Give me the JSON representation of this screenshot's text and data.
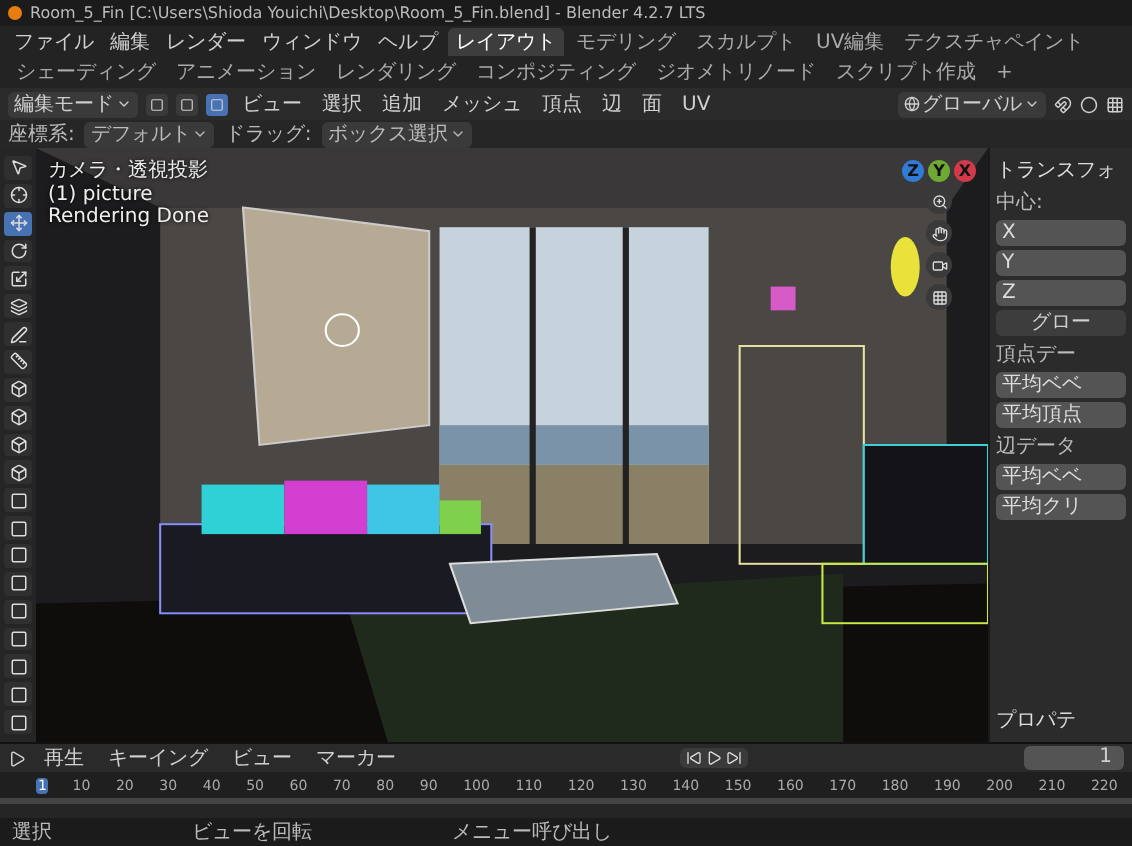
{
  "window": {
    "title": "Room_5_Fin [C:\\Users\\Shioda Youichi\\Desktop\\Room_5_Fin.blend] - Blender 4.2.7 LTS"
  },
  "menu": [
    "ファイル",
    "編集",
    "レンダー",
    "ウィンドウ",
    "ヘルプ"
  ],
  "workspaces": [
    {
      "label": "レイアウト",
      "selected": true
    },
    {
      "label": "モデリング",
      "selected": false
    },
    {
      "label": "スカルプト",
      "selected": false
    },
    {
      "label": "UV編集",
      "selected": false
    },
    {
      "label": "テクスチャペイント",
      "selected": false
    },
    {
      "label": "シェーディング",
      "selected": false
    },
    {
      "label": "アニメーション",
      "selected": false
    },
    {
      "label": "レンダリング",
      "selected": false
    },
    {
      "label": "コンポジティング",
      "selected": false
    },
    {
      "label": "ジオメトリノード",
      "selected": false
    },
    {
      "label": "スクリプト作成",
      "selected": false
    },
    {
      "label": "+",
      "selected": false
    }
  ],
  "header": {
    "mode": "編集モード",
    "select_modes": [
      {
        "selected": false
      },
      {
        "selected": false
      },
      {
        "selected": true
      }
    ],
    "menus": [
      "ビュー",
      "選択",
      "追加",
      "メッシュ",
      "頂点",
      "辺",
      "面",
      "UV"
    ],
    "orientation": "グローバル"
  },
  "subheader": {
    "label": "座標系:",
    "orientation": "デフォルト",
    "drag": "ドラッグ:",
    "select": "ボックス選択"
  },
  "overlay": [
    "カメラ・透視投影",
    "(1) picture",
    "Rendering Done"
  ],
  "tools": [
    {
      "kind": "select",
      "selected": false
    },
    {
      "kind": "cursor",
      "selected": false
    },
    {
      "kind": "move",
      "selected": true
    },
    {
      "kind": "rotate",
      "selected": false
    },
    {
      "kind": "scale",
      "selected": false
    },
    {
      "kind": "transform",
      "selected": false
    },
    {
      "kind": "annotate",
      "selected": false
    },
    {
      "kind": "measure",
      "selected": false
    },
    {
      "kind": "cube",
      "selected": false
    },
    {
      "kind": "extrude",
      "selected": false
    },
    {
      "kind": "inset",
      "selected": false
    },
    {
      "kind": "bevel",
      "selected": false
    },
    {
      "kind": "loopcut",
      "selected": false
    },
    {
      "kind": "knife",
      "selected": false
    },
    {
      "kind": "polybuild",
      "selected": false
    },
    {
      "kind": "spin",
      "selected": false
    },
    {
      "kind": "smooth",
      "selected": false
    },
    {
      "kind": "slide",
      "selected": false
    },
    {
      "kind": "shrink",
      "selected": false
    },
    {
      "kind": "shear",
      "selected": false
    },
    {
      "kind": "rip",
      "selected": false
    }
  ],
  "gizmo": {
    "axes": [
      {
        "label": "Z",
        "color": "#2f7bd6"
      },
      {
        "label": "Y",
        "color": "#6ea934"
      },
      {
        "label": "X",
        "color": "#d23a4a"
      }
    ]
  },
  "n_panel": {
    "title": "トランスフォ",
    "rows": [
      {
        "kind": "label",
        "text": "中心:"
      },
      {
        "kind": "field",
        "text": "X"
      },
      {
        "kind": "field",
        "text": "Y"
      },
      {
        "kind": "field",
        "text": "Z"
      },
      {
        "kind": "button",
        "text": "グロー"
      },
      {
        "kind": "label",
        "text": "頂点デー"
      },
      {
        "kind": "field",
        "text": "平均ベベ"
      },
      {
        "kind": "field",
        "text": "平均頂点"
      },
      {
        "kind": "label",
        "text": "辺データ"
      },
      {
        "kind": "field",
        "text": "平均ベベ"
      },
      {
        "kind": "field",
        "text": "平均クリ"
      }
    ],
    "footer": "プロパテ"
  },
  "timeline": {
    "menus": [
      "再生",
      "キーイング",
      "ビュー",
      "マーカー"
    ],
    "frame": "1",
    "ticks": [
      {
        "label": "1",
        "selected": true
      },
      {
        "label": "10",
        "selected": false
      },
      {
        "label": "20",
        "selected": false
      },
      {
        "label": "30",
        "selected": false
      },
      {
        "label": "40",
        "selected": false
      },
      {
        "label": "50",
        "selected": false
      },
      {
        "label": "60",
        "selected": false
      },
      {
        "label": "70",
        "selected": false
      },
      {
        "label": "80",
        "selected": false
      },
      {
        "label": "90",
        "selected": false
      },
      {
        "label": "100",
        "selected": false
      },
      {
        "label": "110",
        "selected": false
      },
      {
        "label": "120",
        "selected": false
      },
      {
        "label": "130",
        "selected": false
      },
      {
        "label": "140",
        "selected": false
      },
      {
        "label": "150",
        "selected": false
      },
      {
        "label": "160",
        "selected": false
      },
      {
        "label": "170",
        "selected": false
      },
      {
        "label": "180",
        "selected": false
      },
      {
        "label": "190",
        "selected": false
      },
      {
        "label": "200",
        "selected": false
      },
      {
        "label": "210",
        "selected": false
      },
      {
        "label": "220",
        "selected": false
      }
    ]
  },
  "status_bar": [
    "選択",
    "ビューを回転",
    "メニュー呼び出し"
  ]
}
